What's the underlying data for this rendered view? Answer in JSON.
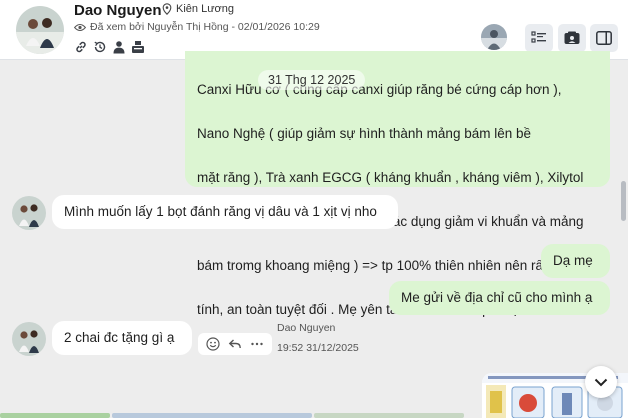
{
  "header": {
    "contact_name": "Dao Nguyen",
    "location": "Kiên Lương",
    "seen_text": "Đã xem bởi Nguyễn Thị Hồng - 02/01/2026 10:29",
    "icons": [
      "link-icon",
      "history-icon",
      "person-icon",
      "cashier-icon"
    ],
    "toolbar": [
      "checklist-icon",
      "contact-card-icon",
      "panel-toggle-icon"
    ]
  },
  "chat": {
    "date_divider": "31 Thg 12 2025",
    "messages": [
      {
        "direction": "out",
        "lines": [
          "Canxi Hữu cơ ( cung cấp canxi giúp răng bé cứng cáp hơn ),",
          "Nano Nghệ ( giúp giảm sự hình thành mảng bám lên bề",
          "mặt răng ), Trà xanh EGCG ( kháng khuẩn , kháng viêm ), Xilytol",
          "( tạo vị ngọt cho sp, ngoài ra có tác dụng giảm vi khuẩn và mảng",
          "bám tromg khoang miệng )  => tp 100% thiên nhiên nên rất lành",
          "tính, an toàn tuyệt đối . Mẹ yên tâm khi bé nuốt phải ạ"
        ]
      },
      {
        "direction": "in",
        "text": "Mình muốn lấy 1 bọt đánh răng vị dâu và 1 xịt vị nho"
      },
      {
        "direction": "out",
        "text": "Dạ mẹ"
      },
      {
        "direction": "out",
        "text": "Me gửi về địa chỉ cũ cho mình ạ"
      },
      {
        "direction": "in",
        "text": "2 chai đc tặng gì ạ",
        "sender": "Dao Nguyen",
        "time": "19:52 31/12/2025"
      }
    ]
  },
  "colors": {
    "outgoing_bubble": "#dcf5d2",
    "incoming_bubble": "#ffffff",
    "chat_background": "#ededed"
  }
}
